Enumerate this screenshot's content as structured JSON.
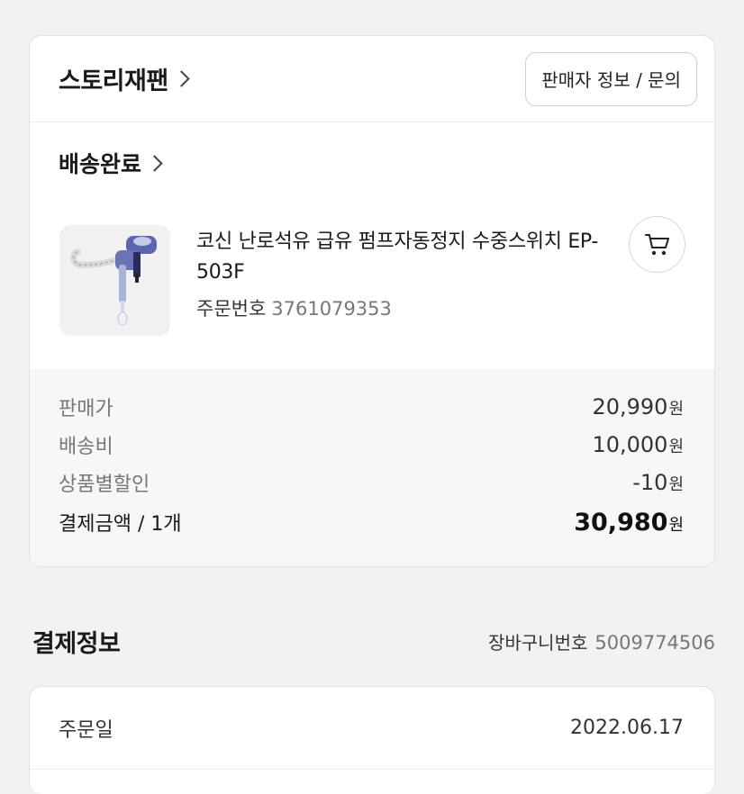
{
  "seller": {
    "name": "스토리재팬",
    "info_button": "판매자 정보 / 문의"
  },
  "order": {
    "status": "배송완료",
    "product": {
      "name": "코신 난로석유 급유 펌프자동정지 수중스위치 EP-503F",
      "order_label": "주문번호",
      "order_number": "3761079353"
    }
  },
  "summary": {
    "currency": "원",
    "rows": [
      {
        "label": "판매가",
        "value": "20,990"
      },
      {
        "label": "배송비",
        "value": "10,000"
      },
      {
        "label": "상품별할인",
        "value": "-10"
      }
    ],
    "total": {
      "label": "결제금액 / 1개",
      "value": "30,980"
    }
  },
  "payment": {
    "title": "결제정보",
    "cart_label": "장바구니번호",
    "cart_number": "5009774506",
    "rows": [
      {
        "label": "주문일",
        "value": "2022.06.17"
      }
    ]
  },
  "icons": {
    "seller_chevron": "chevron-right-icon",
    "status_chevron": "chevron-right-icon",
    "cart": "cart-icon"
  }
}
